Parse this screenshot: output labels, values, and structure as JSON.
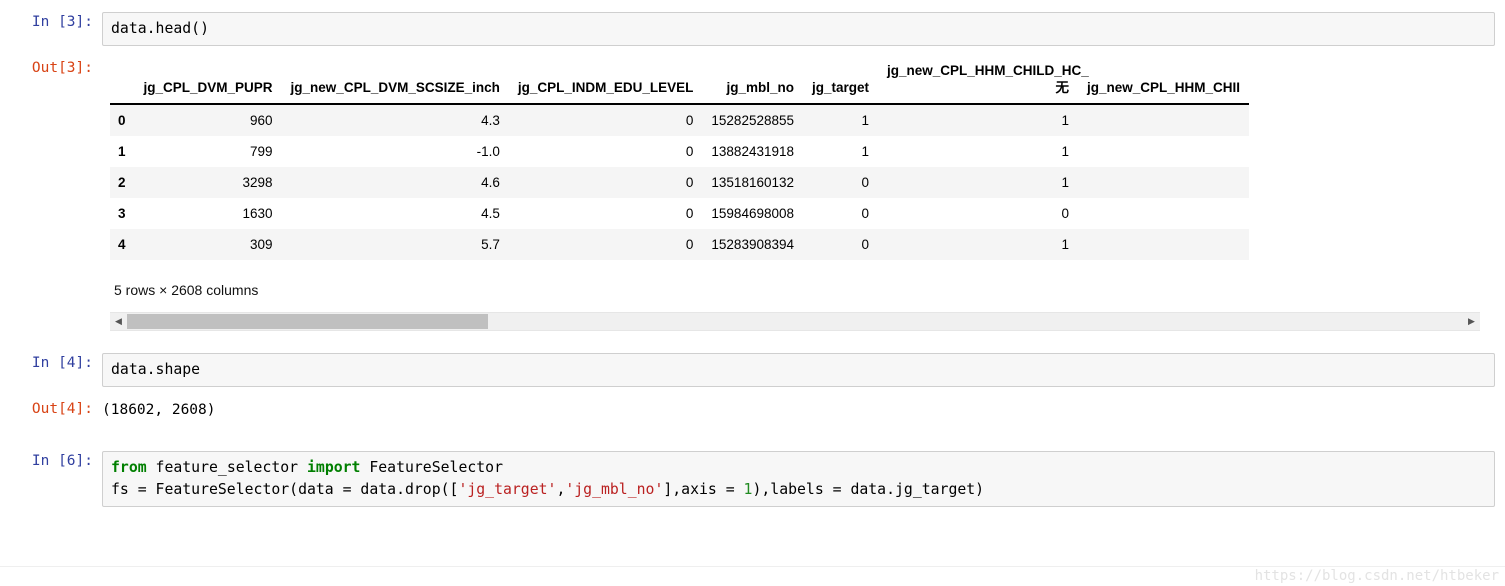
{
  "cells": [
    {
      "prompt_in": "In [3]:",
      "prompt_out": "Out[3]:",
      "source": "data.head()"
    },
    {
      "prompt_in": "In [4]:",
      "prompt_out": "Out[4]:",
      "source": "data.shape",
      "output_text": "(18602, 2608)"
    },
    {
      "prompt_in": "In [6]:",
      "code_line1": {
        "kw1": "from",
        "mod": " feature_selector ",
        "kw2": "import",
        "rest": " FeatureSelector"
      },
      "code_line2": {
        "p1": "fs = FeatureSelector(data = data.drop([",
        "s1": "'jg_target'",
        "p2": ",",
        "s2": "'jg_mbl_no'",
        "p3": "],axis = ",
        "n1": "1",
        "p4": "),labels = data.jg_target)"
      }
    }
  ],
  "dataframe": {
    "index_header": "",
    "columns": [
      "jg_CPL_DVM_PUPR",
      "jg_new_CPL_DVM_SCSIZE_inch",
      "jg_CPL_INDM_EDU_LEVEL",
      "jg_mbl_no",
      "jg_target",
      "jg_new_CPL_HHM_CHILD_HC_无",
      "jg_new_CPL_HHM_CHII"
    ],
    "rows": [
      {
        "index": "0",
        "values": [
          "960",
          "4.3",
          "0",
          "15282528855",
          "1",
          "1",
          ""
        ]
      },
      {
        "index": "1",
        "values": [
          "799",
          "-1.0",
          "0",
          "13882431918",
          "1",
          "1",
          ""
        ]
      },
      {
        "index": "2",
        "values": [
          "3298",
          "4.6",
          "0",
          "13518160132",
          "0",
          "1",
          ""
        ]
      },
      {
        "index": "3",
        "values": [
          "1630",
          "4.5",
          "0",
          "15984698008",
          "0",
          "0",
          ""
        ]
      },
      {
        "index": "4",
        "values": [
          "309",
          "5.7",
          "0",
          "15283908394",
          "0",
          "1",
          ""
        ]
      }
    ],
    "summary": "5 rows × 2608 columns"
  },
  "scrollbar": {
    "left_arrow": "◀",
    "right_arrow": "▶"
  },
  "watermark": "https://blog.csdn.net/htbeker"
}
